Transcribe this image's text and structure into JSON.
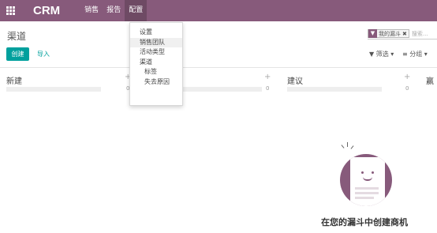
{
  "topbar": {
    "brand": "CRM",
    "menu": [
      "销售",
      "报告",
      "配置"
    ],
    "active_menu": "配置"
  },
  "control_panel": {
    "breadcrumb": "渠道",
    "create_label": "创建",
    "import_label": "导入",
    "search_facet": "我的漏斗",
    "search_placeholder": "搜索...",
    "filter_label": "筛选",
    "group_label": "分组"
  },
  "config_menu": {
    "items": [
      {
        "label": "设置"
      },
      {
        "label": "销售团队"
      },
      {
        "label": "活动类型"
      },
      {
        "label": "渠道"
      },
      {
        "label": "标签"
      },
      {
        "label": "失去原因"
      }
    ]
  },
  "columns": [
    {
      "title": "新建",
      "count": "0"
    },
    {
      "title": "",
      "count": "0"
    },
    {
      "title": "建议",
      "count": "0"
    },
    {
      "title": "赢",
      "count": ""
    }
  ],
  "empty_state": {
    "message": "在您的漏斗中创建商机"
  },
  "colors": {
    "brand": "#875a7b",
    "primary_button": "#00a09d"
  }
}
